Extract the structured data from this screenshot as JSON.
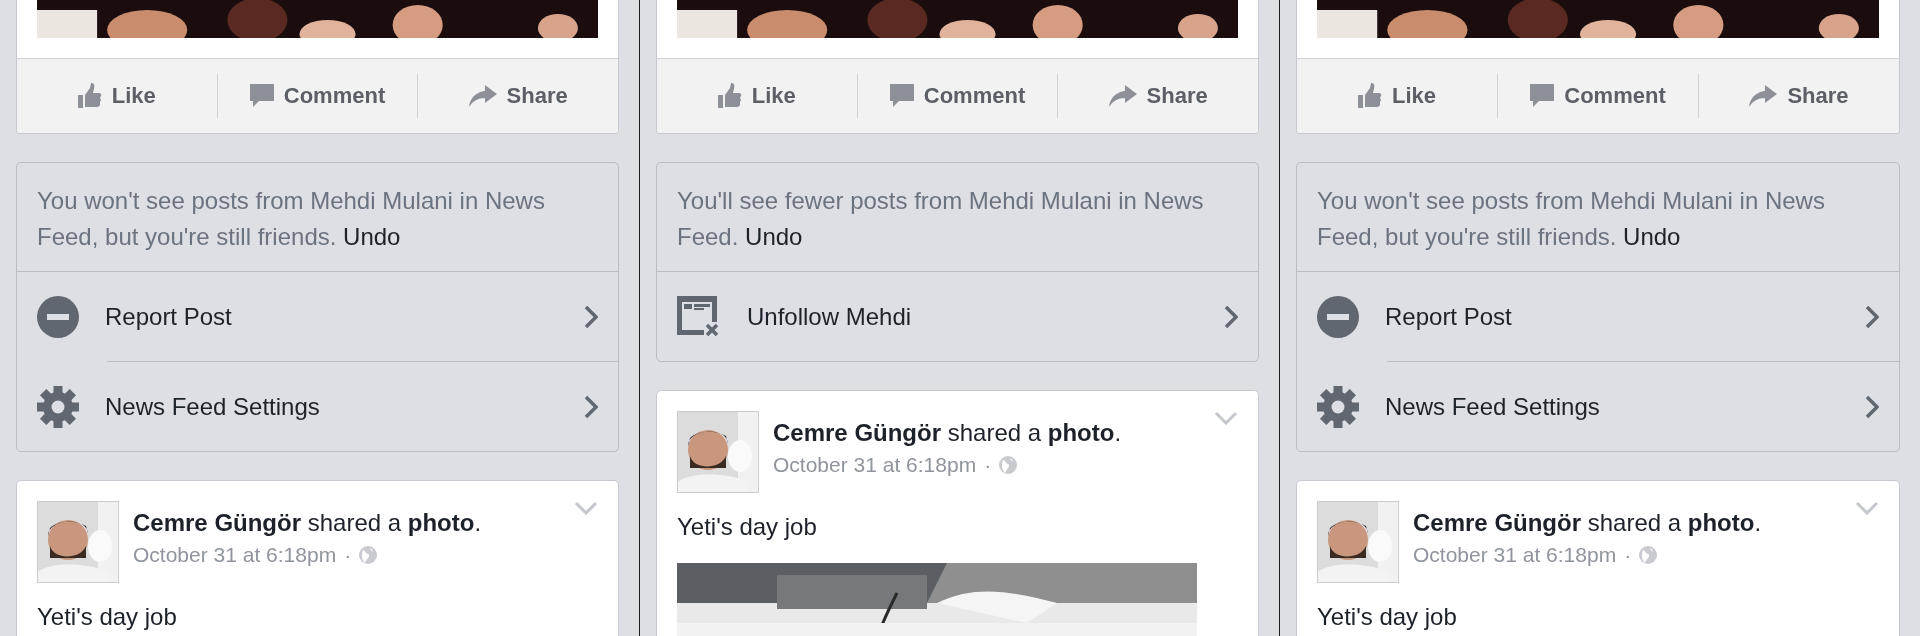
{
  "columns": [
    {
      "top_post": {
        "actions": [
          {
            "kind": "like",
            "label": "Like"
          },
          {
            "kind": "comment",
            "label": "Comment"
          },
          {
            "kind": "share",
            "label": "Share"
          }
        ]
      },
      "feedback": {
        "message": "You won't see posts from Mehdi Mulani in News Feed, but you're still friends.",
        "undo": "Undo",
        "options": [
          {
            "kind": "report",
            "label": "Report Post"
          },
          {
            "kind": "settings",
            "label": "News Feed Settings"
          }
        ]
      },
      "post": {
        "headline": "**Cemre Güngör** shared a **photo**.",
        "time": "October 31 at 6:18pm",
        "separator": "·",
        "text": "Yeti's day job"
      }
    },
    {
      "top_post": {
        "actions": [
          {
            "kind": "like",
            "label": "Like"
          },
          {
            "kind": "comment",
            "label": "Comment"
          },
          {
            "kind": "share",
            "label": "Share"
          }
        ]
      },
      "feedback": {
        "message": "You'll see fewer posts from Mehdi Mulani in News Feed.",
        "undo": "Undo",
        "options": [
          {
            "kind": "unfollow",
            "label": "Unfollow Mehdi"
          }
        ]
      },
      "post": {
        "headline": "**Cemre Güngör** shared a **photo**.",
        "time": "October 31 at 6:18pm",
        "separator": "·",
        "text": "Yeti's day job"
      }
    },
    {
      "top_post": {
        "actions": [
          {
            "kind": "like",
            "label": "Like"
          },
          {
            "kind": "comment",
            "label": "Comment"
          },
          {
            "kind": "share",
            "label": "Share"
          }
        ]
      },
      "feedback": {
        "message": "You won't see posts from Mehdi Mulani in News Feed, but you're still friends.",
        "undo": "Undo",
        "options": [
          {
            "kind": "report",
            "label": "Report Post"
          },
          {
            "kind": "settings",
            "label": "News Feed Settings"
          }
        ]
      },
      "post": {
        "headline": "**Cemre Güngör** shared a **photo**.",
        "time": "October 31 at 6:18pm",
        "separator": "·",
        "text": "Yeti's day job"
      }
    }
  ]
}
